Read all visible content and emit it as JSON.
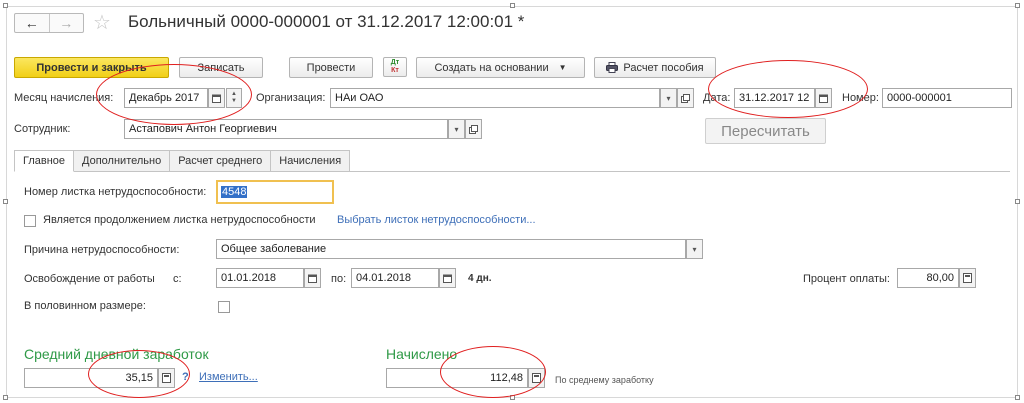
{
  "window": {
    "title": "Больничный 0000-000001 от 31.12.2017 12:00:01 *",
    "nav_back": "←",
    "nav_forward": "→",
    "star": "☆"
  },
  "toolbar": {
    "post_close": "Провести и закрыть",
    "save": "Записать",
    "post": "Провести",
    "dtkt_top": "Дт",
    "dtkt_bottom": "Кт",
    "create_based": "Создать на основании",
    "calc_allowance": "Расчет пособия"
  },
  "header": {
    "month_label": "Месяц начисления:",
    "month_value": "Декабрь 2017",
    "org_label": "Организация:",
    "org_value": "НАи ОАО",
    "date_label": "Дата:",
    "date_value": "31.12.2017 12",
    "number_label": "Номер:",
    "number_value": "0000-000001",
    "employee_label": "Сотрудник:",
    "employee_value": "Астапович Антон Георгиевич",
    "recalc": "Пересчитать"
  },
  "tabs": [
    "Главное",
    "Дополнительно",
    "Расчет среднего",
    "Начисления"
  ],
  "main": {
    "sick_number_label": "Номер листка нетрудоспособности:",
    "sick_number_value": "4548",
    "continuation_label": "Является продолжением листка нетрудоспособности",
    "choose_link": "Выбрать листок нетрудоспособности...",
    "reason_label": "Причина нетрудоспособности:",
    "reason_value": "Общее заболевание",
    "release_label": "Освобождение от работы",
    "from_label": "с:",
    "from_value": "01.01.2018",
    "to_label": "по:",
    "to_value": "04.01.2018",
    "days": "4 дн.",
    "pay_percent_label": "Процент оплаты:",
    "pay_percent_value": "80,00",
    "half_label": "В половинном размере:",
    "avg_title": "Средний дневной заработок",
    "avg_value": "35,15",
    "help": "?",
    "change_link": "Изменить...",
    "accrued_title": "Начислено",
    "accrued_value": "112,48",
    "accrued_note": "По среднему заработку"
  },
  "colors": {
    "primary_button": "#f1cf16",
    "link": "#3e6fb8",
    "section_title": "#2f9a47",
    "annotation_oval": "#e02020",
    "selection": "#3370c8"
  }
}
